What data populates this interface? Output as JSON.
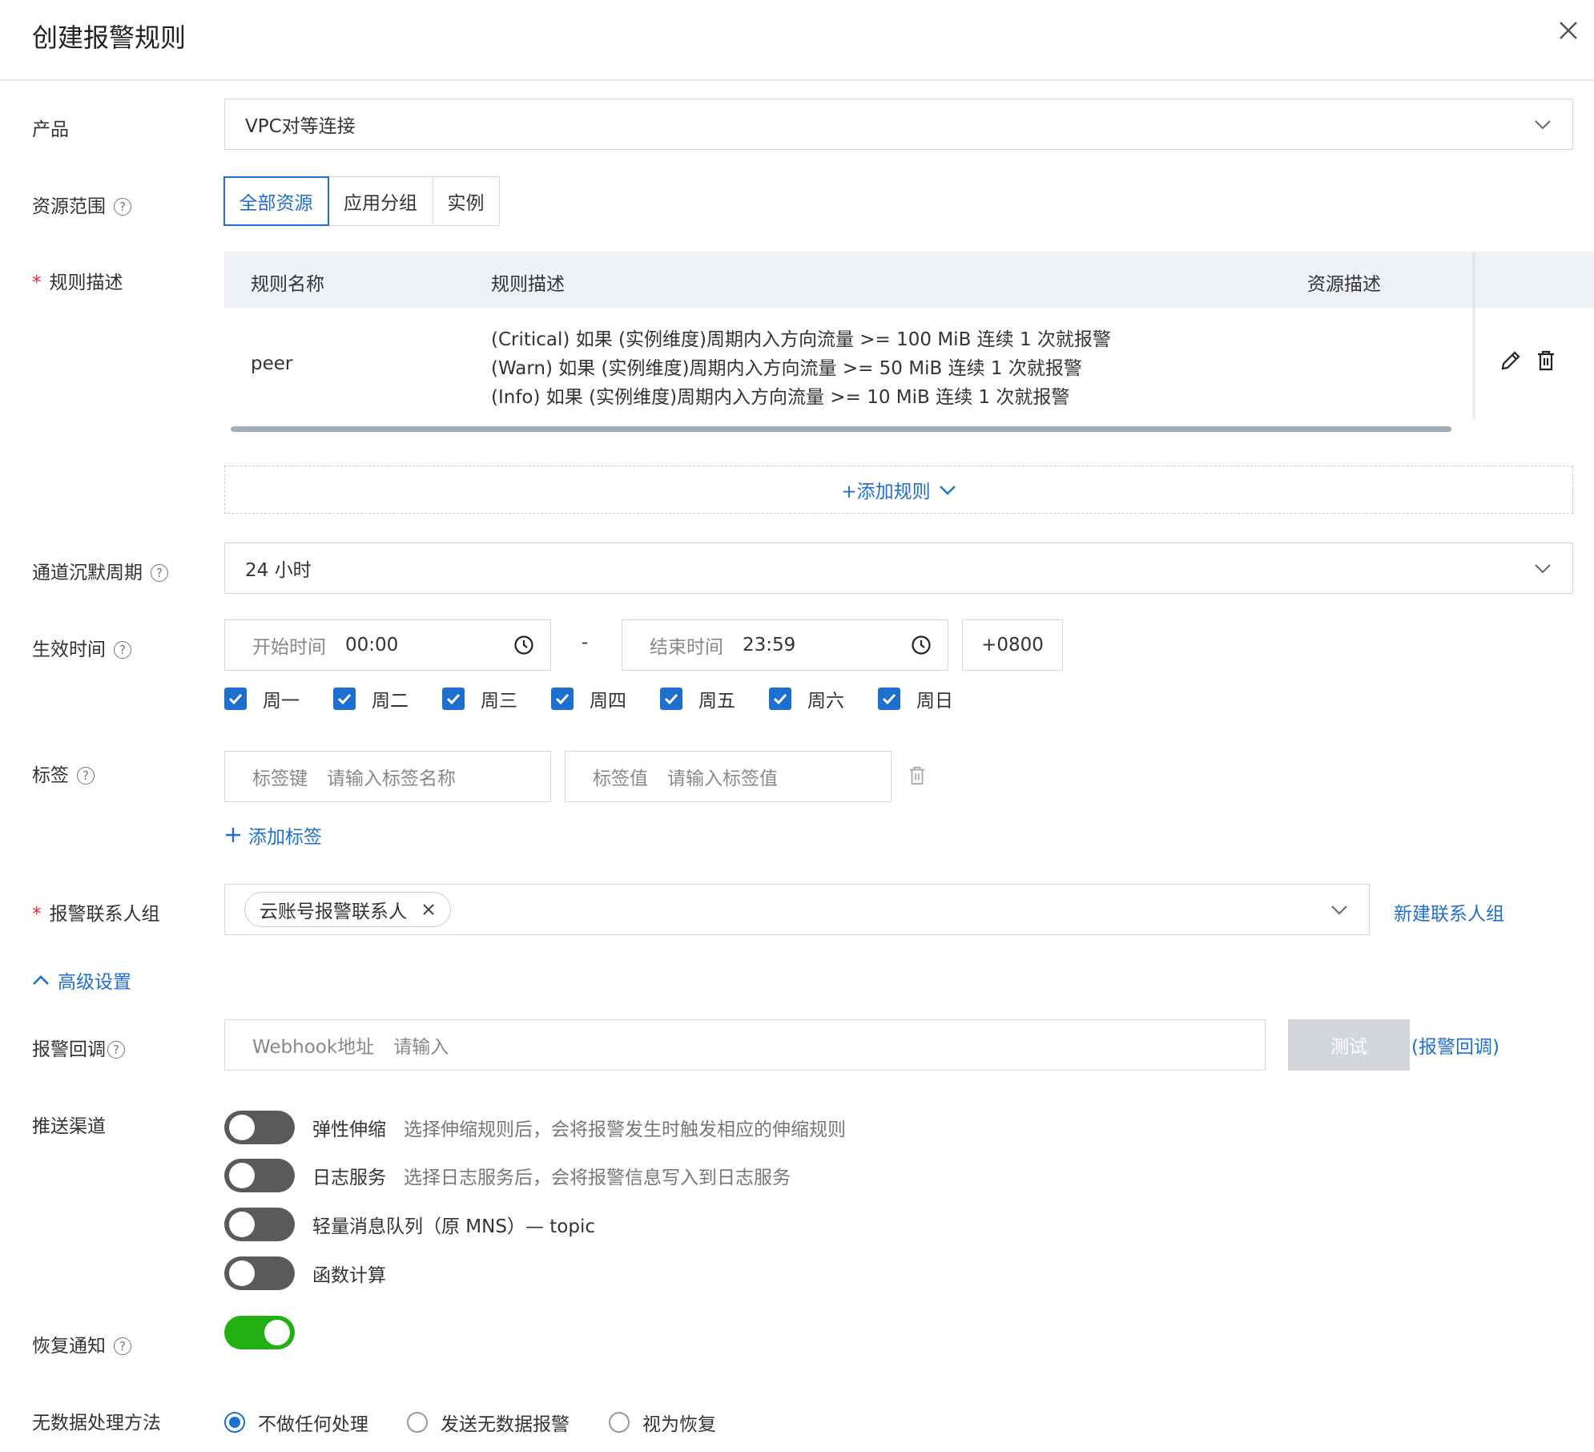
{
  "dialog": {
    "title": "创建报警规则"
  },
  "form": {
    "product": {
      "label": "产品",
      "value": "VPC对等连接"
    },
    "scope": {
      "label": "资源范围",
      "options": [
        "全部资源",
        "应用分组",
        "实例"
      ],
      "selected": "全部资源"
    },
    "rules": {
      "label": "规则描述",
      "columns": [
        "规则名称",
        "规则描述",
        "资源描述"
      ],
      "rows": [
        {
          "name": "peer",
          "lines": [
            "(Critical) 如果 (实例维度)周期内入方向流量 >= 100 MiB 连续 1 次就报警",
            "(Warn) 如果 (实例维度)周期内入方向流量 >= 50 MiB 连续 1 次就报警",
            "(Info) 如果 (实例维度)周期内入方向流量 >= 10 MiB 连续 1 次就报警"
          ]
        }
      ],
      "add_label": "+添加规则"
    },
    "silence": {
      "label": "通道沉默周期",
      "value": "24 小时"
    },
    "effective": {
      "label": "生效时间",
      "start_label": "开始时间",
      "start_value": "00:00",
      "separator": "-",
      "end_label": "结束时间",
      "end_value": "23:59",
      "timezone": "+0800",
      "days": [
        "周一",
        "周二",
        "周三",
        "周四",
        "周五",
        "周六",
        "周日"
      ]
    },
    "tags": {
      "label": "标签",
      "key_label": "标签键",
      "key_placeholder": "请输入标签名称",
      "value_label": "标签值",
      "value_placeholder": "请输入标签值",
      "add_label": "添加标签"
    },
    "contacts": {
      "label": "报警联系人组",
      "chip": "云账号报警联系人",
      "new_link": "新建联系人组"
    },
    "advanced": {
      "label": "高级设置"
    },
    "callback": {
      "label": "报警回调",
      "field_label": "Webhook地址",
      "placeholder": "请输入",
      "test_button": "测试",
      "link": "(报警回调)"
    },
    "push": {
      "label": "推送渠道",
      "channels": [
        {
          "name": "弹性伸缩",
          "desc": "选择伸缩规则后，会将报警发生时触发相应的伸缩规则",
          "on": false
        },
        {
          "name": "日志服务",
          "desc": "选择日志服务后，会将报警信息写入到日志服务",
          "on": false
        },
        {
          "name": "轻量消息队列（原 MNS）— topic",
          "desc": "",
          "on": false
        },
        {
          "name": "函数计算",
          "desc": "",
          "on": false
        }
      ]
    },
    "recovery": {
      "label": "恢复通知",
      "on": true
    },
    "nodata": {
      "label": "无数据处理方法",
      "options": [
        "不做任何处理",
        "发送无数据报警",
        "视为恢复"
      ],
      "selected": "不做任何处理"
    }
  },
  "colors": {
    "accent": "#1f6fd1",
    "toggle_on": "#22b014",
    "toggle_off": "#5a5a5a"
  }
}
